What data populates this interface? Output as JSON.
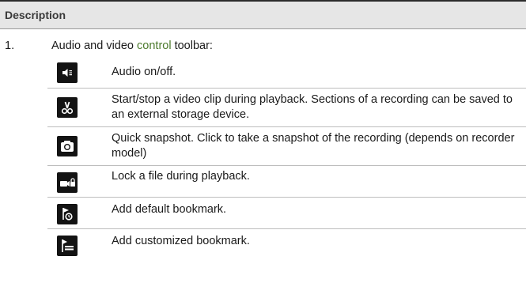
{
  "header": {
    "title": "Description"
  },
  "item": {
    "number": "1.",
    "intro_before": "Audio and video ",
    "intro_link": "control",
    "intro_after": "  toolbar:"
  },
  "rows": [
    {
      "icon": "speaker-icon",
      "text": "Audio on/off."
    },
    {
      "icon": "scissors-icon",
      "text": "Start/stop a video clip during playback. Sections of a recording can be saved to an external storage device."
    },
    {
      "icon": "camera-icon",
      "text": "Quick snapshot. Click to take a snapshot of the recording (depends on recorder model)"
    },
    {
      "icon": "file-lock-icon",
      "text": "Lock a file during playback."
    },
    {
      "icon": "bookmark-default-icon",
      "text": "Add default bookmark."
    },
    {
      "icon": "bookmark-custom-icon",
      "text": "Add customized bookmark."
    }
  ],
  "colors": {
    "link": "#4c7a2c",
    "header_bg": "#e6e6e6",
    "icon_bg": "#131313"
  }
}
